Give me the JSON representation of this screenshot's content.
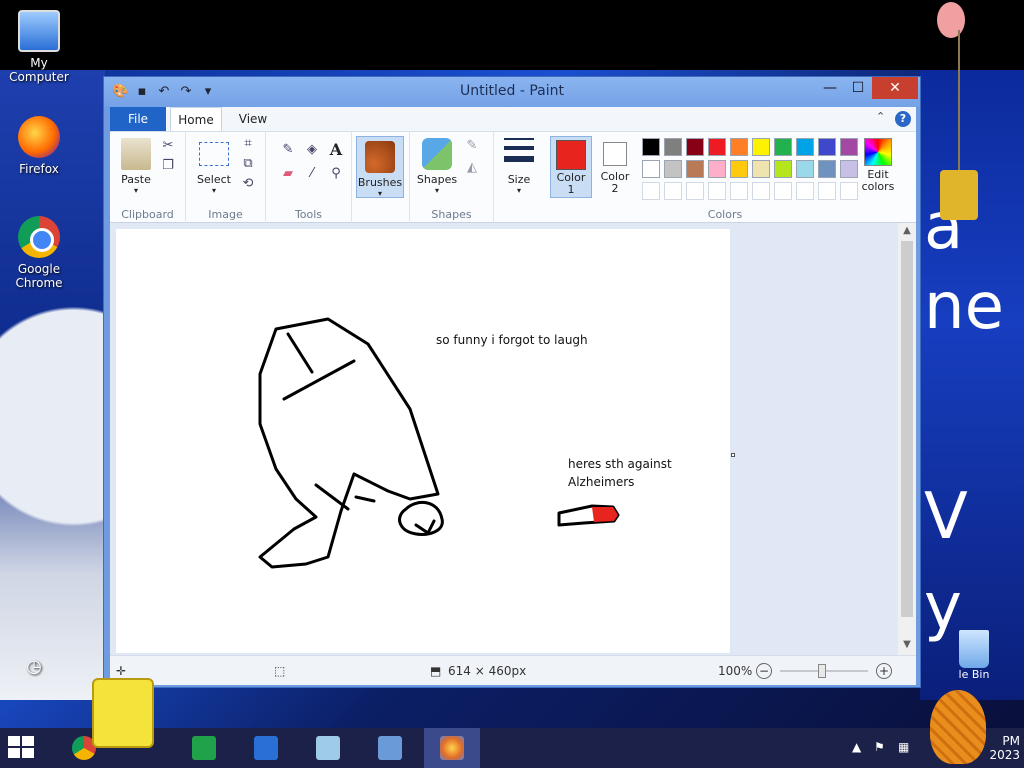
{
  "desktop": {
    "icons": [
      {
        "label": "My Computer",
        "icon": "computer-icon"
      },
      {
        "label": "Firefox",
        "icon": "firefox-icon"
      },
      {
        "label": "Google Chrome",
        "icon": "chrome-icon"
      }
    ],
    "recycle_bin_label": "le Bin",
    "bg_text": [
      "a",
      "ne",
      "V",
      "y"
    ]
  },
  "window": {
    "title": "Untitled - Paint",
    "close_label": "✕",
    "max_label": "☐",
    "min_label": "—"
  },
  "tabs": [
    {
      "label": "File"
    },
    {
      "label": "Home"
    },
    {
      "label": "View"
    }
  ],
  "ribbon": {
    "clipboard": {
      "label": "Clipboard",
      "paste": "Paste"
    },
    "image": {
      "label": "Image",
      "select": "Select"
    },
    "tools": {
      "label": "Tools",
      "text_tool": "A"
    },
    "brushes": {
      "label": "Brushes"
    },
    "shapes": {
      "label": "Shapes",
      "shapes_btn": "Shapes"
    },
    "size": {
      "label": "Size"
    },
    "colors": {
      "label": "Colors",
      "color1": "Color\n1",
      "color1_value": "#e8241f",
      "color2": "Color\n2",
      "color2_value": "#ffffff",
      "edit": "Edit\ncolors",
      "palette_row1": [
        "#000000",
        "#7f7f7f",
        "#880015",
        "#ed1c24",
        "#ff7f27",
        "#fff200",
        "#22b14c",
        "#00a2e8",
        "#3f48cc",
        "#a349a4"
      ],
      "palette_row2": [
        "#ffffff",
        "#c3c3c3",
        "#b97a57",
        "#ffaec9",
        "#ffc90e",
        "#efe4b0",
        "#b5e61d",
        "#99d9ea",
        "#7092be",
        "#c8bfe7"
      ]
    }
  },
  "canvas": {
    "text1": "so funny i forgot to laugh",
    "text2": "heres sth against\nAlzheimers"
  },
  "status": {
    "dimensions": "614 × 460px",
    "zoom": "100%",
    "zoom_out": "−",
    "zoom_in": "+"
  },
  "taskbar": {
    "clock": "PM",
    "date": "2023"
  }
}
